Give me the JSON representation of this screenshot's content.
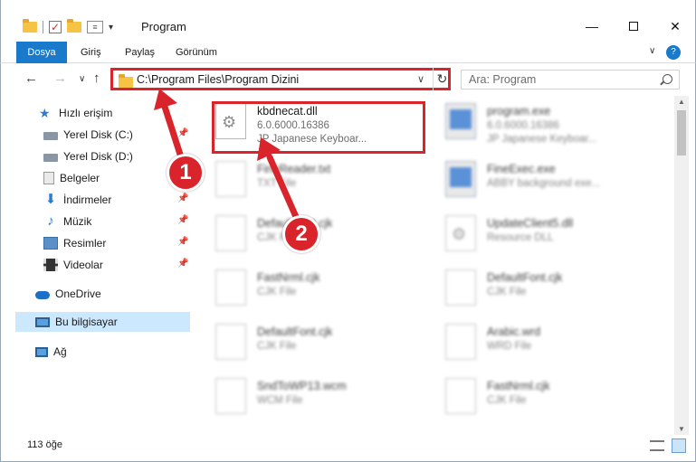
{
  "window": {
    "title": "Program",
    "minimize_glyph": "—",
    "close_glyph": "✕",
    "dropdown_glyph": "▾"
  },
  "ribbon": {
    "tabs": [
      "Dosya",
      "Giriş",
      "Paylaş",
      "Görünüm"
    ],
    "chevron_glyph": "∨",
    "help_glyph": "?"
  },
  "nav": {
    "back_glyph": "←",
    "forward_glyph": "→",
    "recent_glyph": "∨",
    "up_glyph": "↑"
  },
  "address": {
    "path": "C:\\Program Files\\Program Dizini",
    "dropdown_glyph": "∨",
    "refresh_glyph": "↻"
  },
  "search": {
    "placeholder": "Ara: Program"
  },
  "sidebar": {
    "items": [
      {
        "label": "Hızlı erişim",
        "icon": "star-icon"
      },
      {
        "label": "Yerel Disk (C:)",
        "icon": "drive-icon",
        "pinned": true
      },
      {
        "label": "Yerel Disk (D:)",
        "icon": "drive-icon"
      },
      {
        "label": "Belgeler",
        "icon": "documents-icon",
        "pinned": true
      },
      {
        "label": "İndirmeler",
        "icon": "download-icon",
        "pinned": true
      },
      {
        "label": "Müzik",
        "icon": "music-icon",
        "pinned": true
      },
      {
        "label": "Resimler",
        "icon": "pictures-icon",
        "pinned": true
      },
      {
        "label": "Videolar",
        "icon": "video-icon",
        "pinned": true
      },
      {
        "label": "OneDrive",
        "icon": "cloud-icon"
      },
      {
        "label": "Bu bilgisayar",
        "icon": "computer-icon",
        "selected": true
      },
      {
        "label": "Ağ",
        "icon": "network-icon"
      }
    ],
    "pin_glyph": "📌"
  },
  "files": [
    {
      "name": "kbdnecat.dll",
      "version": "6.0.6000.16386",
      "desc": "JP Japanese Keyboar...",
      "type": "dll",
      "highlighted": true
    },
    {
      "name": "program.exe",
      "version": "6.0.6000.16386",
      "desc": "JP Japanese Keyboar...",
      "type": "exe"
    },
    {
      "name": "FineReader.txt",
      "version": "",
      "desc": "TXT File",
      "type": "doc"
    },
    {
      "name": "FineExec.exe",
      "version": "",
      "desc": "ABBY background exe...",
      "type": "exe"
    },
    {
      "name": "DefaultFont.cjk",
      "version": "",
      "desc": "CJK File",
      "type": "doc"
    },
    {
      "name": "UpdateClient5.dll",
      "version": "",
      "desc": "Resource DLL",
      "type": "dll"
    },
    {
      "name": "FastNrml.cjk",
      "version": "",
      "desc": "CJK File",
      "type": "doc"
    },
    {
      "name": "DefaultFont.cjk",
      "version": "",
      "desc": "CJK File",
      "type": "doc"
    },
    {
      "name": "DefaultFont.cjk",
      "version": "",
      "desc": "CJK File",
      "type": "doc"
    },
    {
      "name": "Arabic.wrd",
      "version": "",
      "desc": "WRD File",
      "type": "doc"
    },
    {
      "name": "SndToWP13.wcm",
      "version": "",
      "desc": "WCM File",
      "type": "doc"
    },
    {
      "name": "FastNrml.cjk",
      "version": "",
      "desc": "CJK File",
      "type": "doc"
    }
  ],
  "status": {
    "count": "113 öğe"
  },
  "callouts": [
    {
      "number": "1",
      "target": "address-bar"
    },
    {
      "number": "2",
      "target": "file-kbdnecat"
    }
  ],
  "colors": {
    "accent": "#1979ca",
    "highlight_red": "#d9242b",
    "selection": "#cce8ff"
  }
}
